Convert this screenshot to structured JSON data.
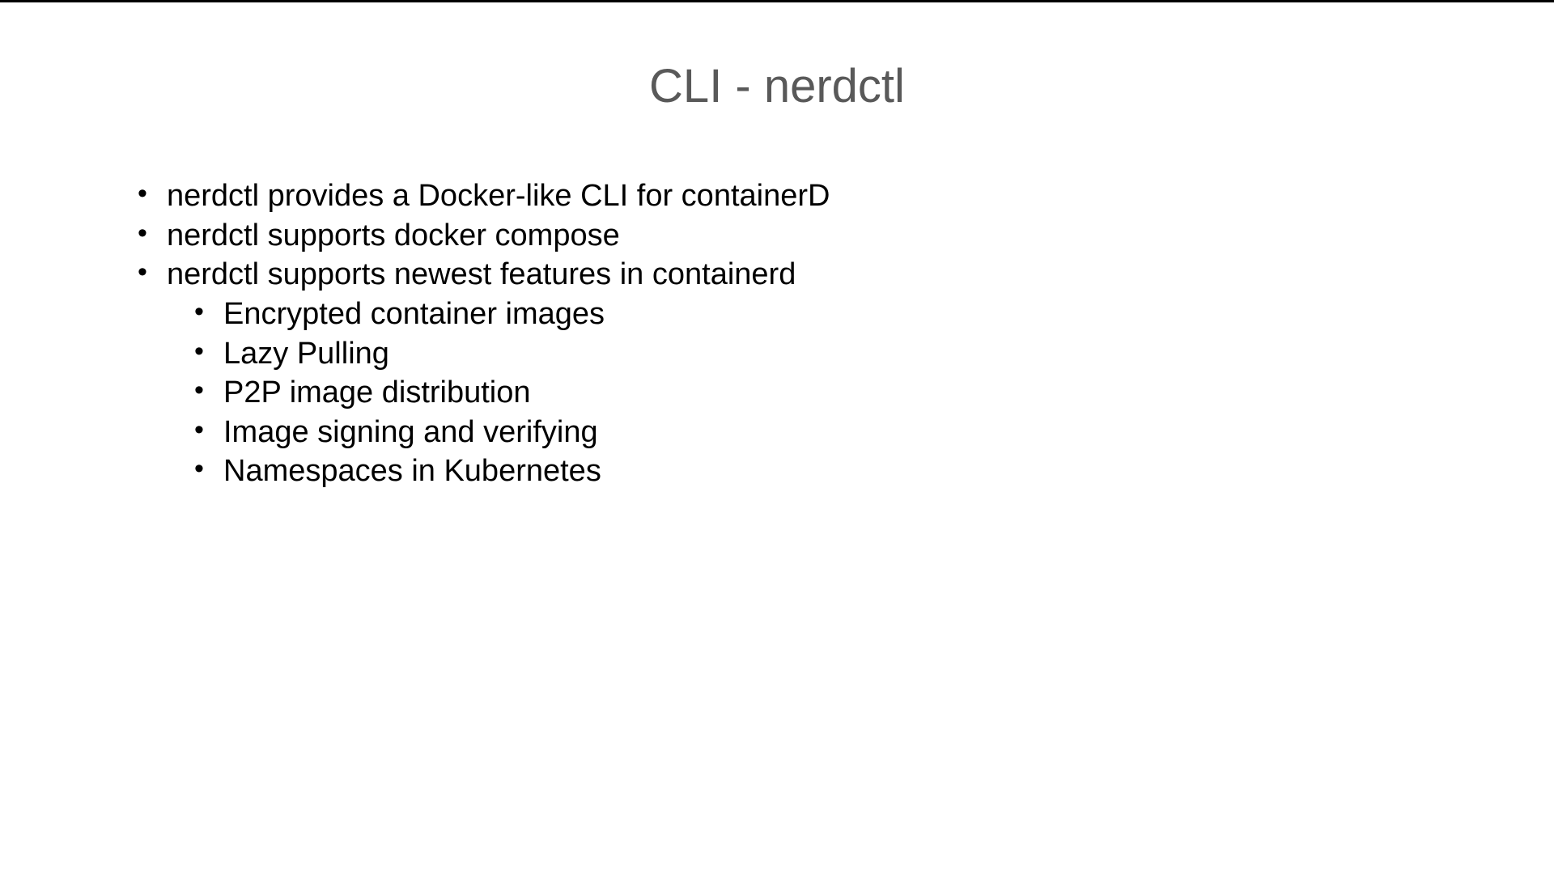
{
  "slide": {
    "title": "CLI - nerdctl",
    "bullets": [
      {
        "text": "nerdctl provides a Docker-like CLI for containerD"
      },
      {
        "text": "nerdctl supports docker compose"
      },
      {
        "text": "nerdctl supports newest features in containerd",
        "sub": [
          "Encrypted container images",
          "Lazy Pulling",
          "P2P image distribution",
          "Image signing and verifying",
          "Namespaces in Kubernetes"
        ]
      }
    ]
  }
}
